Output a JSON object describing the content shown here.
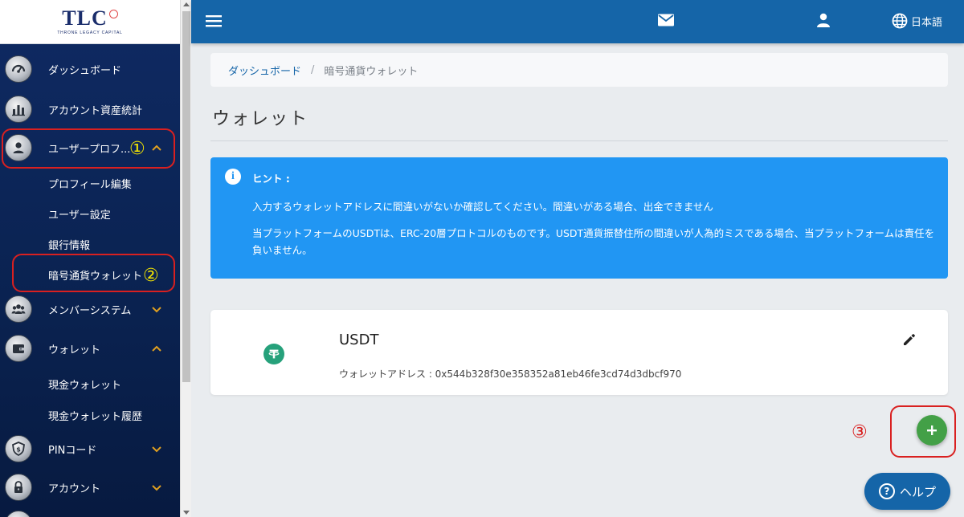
{
  "brand": {
    "logo_text": "TLC",
    "logo_subtitle": "THRONE LEGACY CAPITAL"
  },
  "sidebar": {
    "items": [
      {
        "label": "ダッシュボード",
        "icon": "speedometer-icon"
      },
      {
        "label": "アカウント資産統計",
        "icon": "bar-chart-icon"
      },
      {
        "label": "ユーザープロフ...",
        "icon": "user-icon",
        "expanded": true,
        "children": [
          "プロフィール編集",
          "ユーザー設定",
          "銀行情報",
          "暗号通貨ウォレット"
        ]
      },
      {
        "label": "メンバーシステム",
        "icon": "group-icon",
        "expanded": false
      },
      {
        "label": "ウォレット",
        "icon": "wallet-icon",
        "expanded": true,
        "children": [
          "現金ウォレット",
          "現金ウォレット履歴"
        ]
      },
      {
        "label": "PINコード",
        "icon": "pin-shield-icon",
        "expanded": false
      },
      {
        "label": "アカウント",
        "icon": "lock-icon",
        "expanded": false
      }
    ]
  },
  "annotations": {
    "n1": "①",
    "n2": "②",
    "n3": "③",
    "box_color": "#d92020",
    "num_color_sidebar": "#f5e600",
    "num_color_main": "#d92020"
  },
  "topbar": {
    "language": "日本語",
    "color": "#1565a8"
  },
  "breadcrumb": {
    "home": "ダッシュボード",
    "separator": "/",
    "current": "暗号通貨ウォレット"
  },
  "page": {
    "title": "ウォレット"
  },
  "hint": {
    "title": "ヒント :",
    "line1": "入力するウォレットアドレスに間違いがないか確認してください。間違いがある場合、出金できません",
    "line2": "当プラットフォームのUSDTは、ERC-20層プロトコルのものです。USDT通貨振替住所の間違いが人為的ミスである場合、当プラットフォームは責任を負いません。",
    "color": "#2196f3"
  },
  "wallet_card": {
    "coin": "USDT",
    "address_label": "ウォレットアドレス : 0x544b328f30e358352a81eb46fe3cd74d3dbcf970",
    "coin_color": "#26a17b"
  },
  "buttons": {
    "add": "+",
    "help": "ヘルプ",
    "help_q": "?"
  }
}
